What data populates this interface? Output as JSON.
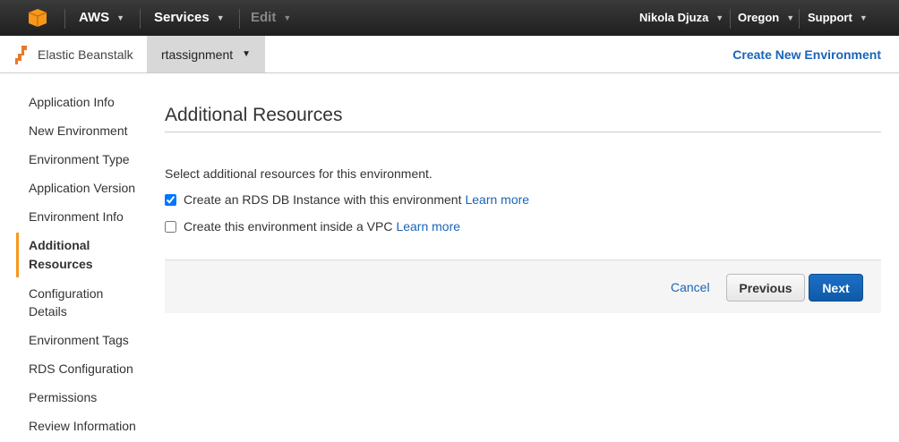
{
  "topnav": {
    "aws": "AWS",
    "services": "Services",
    "edit": "Edit",
    "user": "Nikola Djuza",
    "region": "Oregon",
    "support": "Support"
  },
  "subnav": {
    "brand": "Elastic Beanstalk",
    "app": "rtassignment",
    "create": "Create New Environment"
  },
  "sidebar": {
    "items": [
      "Application Info",
      "New Environment",
      "Environment Type",
      "Application Version",
      "Environment Info",
      "Additional Resources",
      "Configuration Details",
      "Environment Tags",
      "RDS Configuration",
      "Permissions",
      "Review Information"
    ]
  },
  "main": {
    "title": "Additional Resources",
    "description": "Select additional resources for this environment.",
    "options": [
      {
        "label": "Create an RDS DB Instance with this environment",
        "link": "Learn more",
        "checked": true
      },
      {
        "label": "Create this environment inside a VPC",
        "link": "Learn more",
        "checked": false
      }
    ]
  },
  "footer": {
    "cancel": "Cancel",
    "previous": "Previous",
    "next": "Next"
  }
}
